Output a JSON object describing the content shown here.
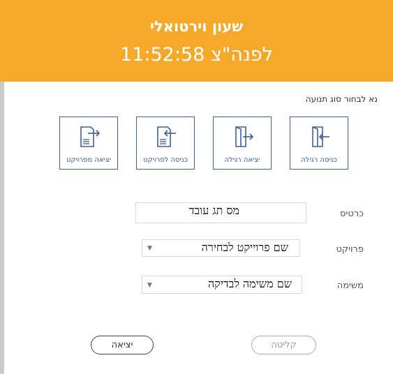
{
  "header": {
    "title": "שעון וירטואלי",
    "time": "11:52:58 לפנה\"צ",
    "color": "#f6a829"
  },
  "instruction": "נא לבחור סוג תנועה",
  "movement_types": [
    {
      "label": "יציאה מפרויקט",
      "icon": "exit-project-icon"
    },
    {
      "label": "כניסה לפרויקט",
      "icon": "enter-project-icon"
    },
    {
      "label": "יציאה רגילה",
      "icon": "exit-door-icon"
    },
    {
      "label": "כניסה רגילה",
      "icon": "enter-door-icon"
    }
  ],
  "form": {
    "card_label": "כרטיס",
    "card_value": "מס תג עובד",
    "project_label": "פרויקט",
    "project_value": "שם פרוייקט לבחירה",
    "task_label": "משימה",
    "task_value": "שם משימה לבדיקה",
    "dropdown_arrow": "▼"
  },
  "buttons": {
    "exit": "יציאה",
    "receive": "קליטה"
  },
  "colors": {
    "accent_blue": "#3a5f9c"
  }
}
